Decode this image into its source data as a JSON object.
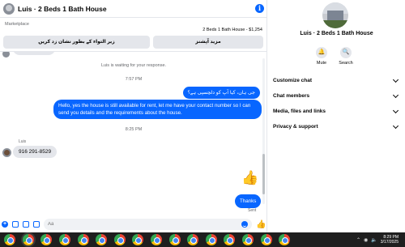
{
  "header": {
    "title": "Luis · 2 Beds 1 Bath House"
  },
  "marketplace": {
    "label": "Marketplace",
    "item": "2 Beds 1 Bath House - $1,254",
    "button_left": "زیر التواء کے بطور نشان زد کریں",
    "button_right": "مزید آپشنز"
  },
  "thread": {
    "system_message": "Luis is waiting for your response.",
    "time_1": "7:57 PM",
    "out_urdu": "جی ہاں، کیا آپ کو دلچسپی ہے؟",
    "out_long": "Hello, yes the house is still available for rent, let me have your contact number so I can send you details and the requirements about the house.",
    "time_2": "8:25 PM",
    "sender_name": "Luis",
    "in_phone": "916 291-8529",
    "out_thanks": "Thanks",
    "sent_status": "Sent"
  },
  "composer": {
    "placeholder": "Aa"
  },
  "side": {
    "name": "Luis · 2 Beds 1 Bath House",
    "mute_label": "Mute",
    "search_label": "Search",
    "rows": [
      "Customize chat",
      "Chat members",
      "Media, files and links",
      "Privacy & support"
    ]
  },
  "taskbar": {
    "time": "8:29 PM",
    "date": "3/17/2025",
    "app_icon": "chrome-icon",
    "app_count": 16
  },
  "colors": {
    "accent": "#0866ff",
    "bubble_in": "#e4e6eb",
    "taskbar": "#1f1f1f"
  }
}
